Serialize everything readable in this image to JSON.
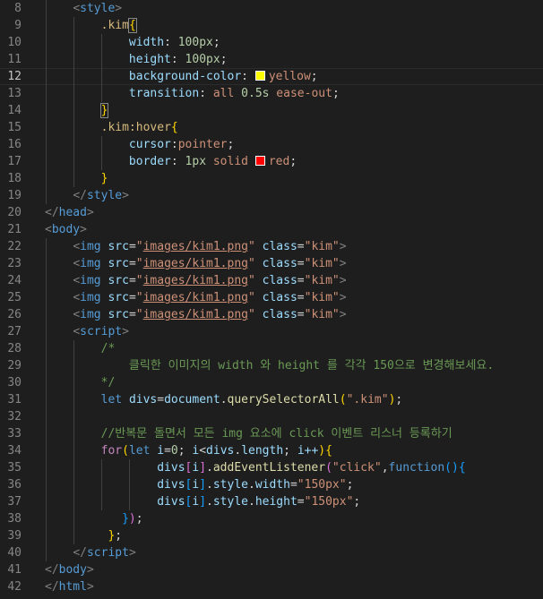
{
  "editor": {
    "colors": {
      "background": "#1e1e1e",
      "yellow_swatch": "#ffff00",
      "red_swatch": "#ff0000"
    },
    "lines": [
      {
        "n": "8",
        "t": {
          "a": "<",
          "b": "style",
          "c": ">"
        }
      },
      {
        "n": "9",
        "t": {
          "sel": ".kim",
          "ob": "{"
        }
      },
      {
        "n": "10",
        "t": {
          "p": "width",
          "c": ": ",
          "v": "100px",
          "s": ";"
        }
      },
      {
        "n": "11",
        "t": {
          "p": "height",
          "c": ": ",
          "v": "100px",
          "s": ";"
        }
      },
      {
        "n": "12",
        "t": {
          "p": "background-color",
          "c": ": ",
          "v": "yellow",
          "s": ";"
        }
      },
      {
        "n": "13",
        "t": {
          "p": "transition",
          "c": ": ",
          "v1": "all ",
          "v2": "0.5s",
          "v3": " ease-out",
          "s": ";"
        }
      },
      {
        "n": "14",
        "t": {
          "cb": "}"
        }
      },
      {
        "n": "15",
        "t": {
          "sel": ".kim:hover",
          "ob": "{"
        }
      },
      {
        "n": "16",
        "t": {
          "p": "cursor",
          "c": ":",
          "v": "pointer",
          "s": ";"
        }
      },
      {
        "n": "17",
        "t": {
          "p": "border",
          "c": ": ",
          "v1": "1px",
          "v2": " solid ",
          "v3": "red",
          "s": ";"
        }
      },
      {
        "n": "18",
        "t": {
          "cb": "}"
        }
      },
      {
        "n": "19",
        "t": {
          "a": "</",
          "b": "style",
          "c": ">"
        }
      },
      {
        "n": "20",
        "t": {
          "a": "</",
          "b": "head",
          "c": ">"
        }
      },
      {
        "n": "21",
        "t": {
          "a": "<",
          "b": "body",
          "c": ">"
        }
      },
      {
        "n": "22"
      },
      {
        "n": "23"
      },
      {
        "n": "24"
      },
      {
        "n": "25"
      },
      {
        "n": "26"
      },
      {
        "n": "27",
        "t": {
          "a": "<",
          "b": "script",
          "c": ">"
        }
      },
      {
        "n": "28",
        "t": {
          "cm": "/*"
        }
      },
      {
        "n": "29",
        "t": {
          "cm": "    클릭한 이미지의 width 와 height 를 각각 150으로 변경해보세요."
        }
      },
      {
        "n": "30",
        "t": {
          "cm": "*/"
        }
      },
      {
        "n": "31"
      },
      {
        "n": "32"
      },
      {
        "n": "33",
        "t": {
          "cm": "//반복문 돌면서 모든 img 요소에 click 이벤트 리스너 등록하기"
        }
      },
      {
        "n": "34"
      },
      {
        "n": "35"
      },
      {
        "n": "36"
      },
      {
        "n": "37"
      },
      {
        "n": "38"
      },
      {
        "n": "39"
      },
      {
        "n": "40",
        "t": {
          "a": "</",
          "b": "script",
          "c": ">"
        }
      },
      {
        "n": "41",
        "t": {
          "a": "</",
          "b": "body",
          "c": ">"
        }
      },
      {
        "n": "42",
        "t": {
          "a": "</",
          "b": "html",
          "c": ">"
        }
      }
    ],
    "img": {
      "open": "<",
      "tag": "img",
      "src_attr": " src",
      "eq": "=",
      "q": "\"",
      "src": "images/kim1.png",
      "class_attr": " class",
      "cls": "kim",
      "close": ">"
    },
    "js": {
      "let": "let",
      "divs": "divs",
      "eq": "=",
      "document": "document",
      "dot": ".",
      "qsa": "querySelectorAll",
      "po": "(",
      "sel": "\".kim\"",
      "pc": ")",
      "semi": ";",
      "for": "for",
      "i": "i",
      "zero": "0",
      "lt": "<",
      "length": "length",
      "inc": "i++",
      "addEventListener": "addEventListener",
      "click": "\"click\"",
      "comma": ",",
      "function": "function",
      "style": "style",
      "width": "width",
      "height": "height",
      "v150": "\"150px\""
    }
  }
}
